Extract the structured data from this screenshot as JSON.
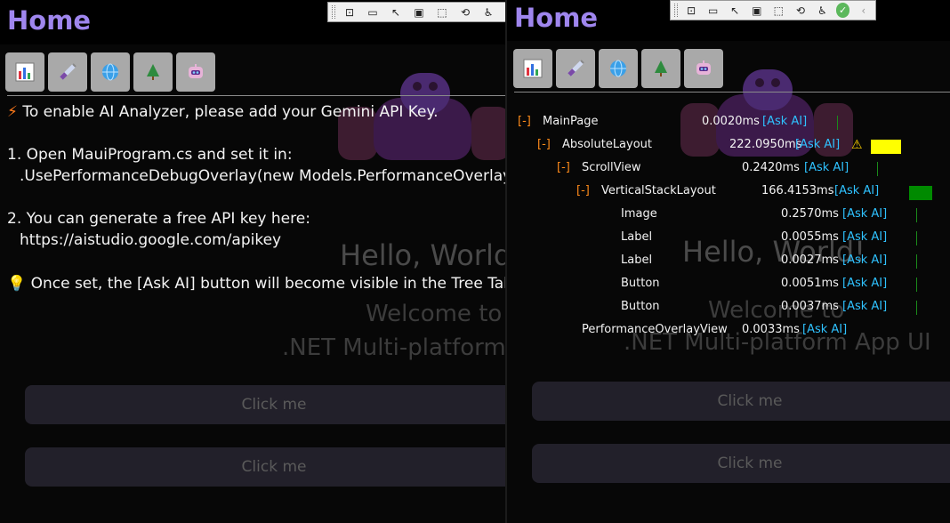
{
  "colors": {
    "accent": "#9f86ee",
    "ask_ai": "#2fc2ff",
    "toggle": "#ff8c1a",
    "warn_bar": "#ffff00",
    "ok_bar": "#008a00"
  },
  "left": {
    "title": "Home",
    "toolbar_icons": [
      "grip-icon",
      "frame-select-icon",
      "camera-icon",
      "pointer-icon",
      "box-select-icon",
      "pointer-select-icon",
      "hot-reload-icon",
      "accessibility-icon"
    ],
    "tabs": [
      {
        "name": "charts-tab",
        "icon": "bar-chart-icon"
      },
      {
        "name": "memory-tab",
        "icon": "syringe-icon"
      },
      {
        "name": "network-tab",
        "icon": "globe-icon"
      },
      {
        "name": "tree-tab",
        "icon": "tree-icon"
      },
      {
        "name": "ai-tab",
        "icon": "robot-icon"
      }
    ],
    "messages": {
      "line1": "To enable AI Analyzer, please add your Gemini API Key.",
      "line2": "1. Open MauiProgram.cs and set it in:",
      "line3": ".UsePerformanceDebugOverlay(new Models.PerformanceOverlayO",
      "line4": "2. You can generate a free API key here:",
      "line5": "https://aistudio.google.com/apikey",
      "line6": "Once set, the [Ask AI] button will become visible in the Tree Tab."
    },
    "app": {
      "hello": "Hello, World!",
      "welcome": "Welcome to",
      "platform": ".NET Multi-platform App UI",
      "button1": "Click me",
      "button2": "Click me"
    }
  },
  "right": {
    "title": "Home",
    "toolbar_icons": [
      "grip-icon",
      "frame-select-icon",
      "camera-icon",
      "pointer-icon",
      "box-select-icon",
      "pointer-select-icon",
      "hot-reload-icon",
      "accessibility-icon",
      "check-circle-icon",
      "chevron-left-icon"
    ],
    "tree": [
      {
        "toggle": "[-]",
        "name": "MainPage",
        "time": "0.0020ms",
        "ask": "[Ask AI]",
        "warn": false,
        "bar": "none"
      },
      {
        "toggle": "[-]",
        "name": "AbsoluteLayout",
        "time": "222.0950ms",
        "ask": "[Ask AI]",
        "warn": true,
        "bar": "yellow"
      },
      {
        "toggle": "[-]",
        "name": "ScrollView",
        "time": "0.2420ms",
        "ask": "[Ask AI]",
        "warn": false,
        "bar": "none"
      },
      {
        "toggle": "[-]",
        "name": "VerticalStackLayout",
        "time": "166.4153ms",
        "ask": "[Ask AI]",
        "warn": false,
        "bar": "green"
      },
      {
        "toggle": "",
        "name": "Image",
        "time": "0.2570ms",
        "ask": "[Ask AI]",
        "warn": false,
        "bar": "none"
      },
      {
        "toggle": "",
        "name": "Label",
        "time": "0.0055ms",
        "ask": "[Ask AI]",
        "warn": false,
        "bar": "none"
      },
      {
        "toggle": "",
        "name": "Label",
        "time": "0.0027ms",
        "ask": "[Ask AI]",
        "warn": false,
        "bar": "none"
      },
      {
        "toggle": "",
        "name": "Button",
        "time": "0.0051ms",
        "ask": "[Ask AI]",
        "warn": false,
        "bar": "none"
      },
      {
        "toggle": "",
        "name": "Button",
        "time": "0.0037ms",
        "ask": "[Ask AI]",
        "warn": false,
        "bar": "none"
      },
      {
        "toggle": "",
        "name": "PerformanceOverlayView",
        "time": "0.0033ms",
        "ask": "[Ask AI]",
        "warn": false,
        "bar": "none"
      }
    ],
    "app": {
      "hello": "Hello, World!",
      "welcome": "Welcome to",
      "platform": ".NET Multi-platform App UI",
      "button1": "Click me",
      "button2": "Click me"
    }
  }
}
